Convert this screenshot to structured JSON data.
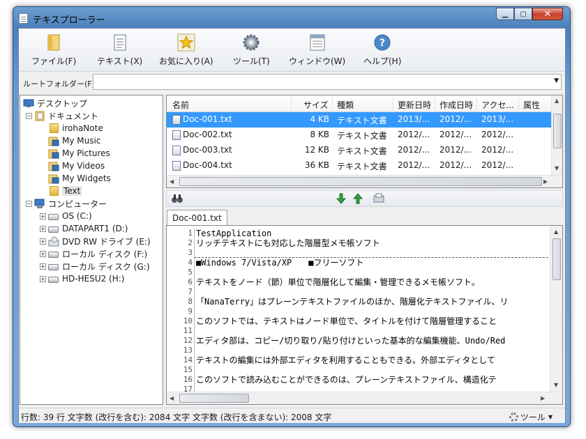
{
  "window": {
    "title": "テキスプローラー"
  },
  "toolbar": {
    "items": [
      {
        "label": "ファイル(F)",
        "icon": "folder-icon"
      },
      {
        "label": "テキスト(X)",
        "icon": "text-document-icon"
      },
      {
        "label": "お気に入り(A)",
        "icon": "star-icon"
      },
      {
        "label": "ツール(T)",
        "icon": "gear-icon"
      },
      {
        "label": "ウィンドウ(W)",
        "icon": "window-icon"
      },
      {
        "label": "ヘルプ(H)",
        "icon": "help-icon"
      }
    ]
  },
  "rootfolder": {
    "label": "ルートフォルダー(F):",
    "value": ""
  },
  "tree": {
    "desktop": "デスクトップ",
    "documents": "ドキュメント",
    "doc_children": [
      "irohaNote",
      "My Music",
      "My Pictures",
      "My Videos",
      "My Widgets",
      "Text"
    ],
    "computer": "コンピューター",
    "drives": [
      "OS (C:)",
      "DATAPART1 (D:)",
      "DVD RW ドライブ (E:)",
      "ローカル ディスク (F:)",
      "ローカル ディスク (G:)",
      "HD-HESU2 (H:)"
    ]
  },
  "filelist": {
    "columns": [
      "名前",
      "サイズ",
      "種類",
      "更新日時",
      "作成日時",
      "アクセ...",
      "属性"
    ],
    "rows": [
      {
        "name": "Doc-001.txt",
        "size": "4 KB",
        "type": "テキスト文書",
        "modified": "2013/...",
        "created": "2012/...",
        "accessed": "2013/...",
        "attr": ""
      },
      {
        "name": "Doc-002.txt",
        "size": "8 KB",
        "type": "テキスト文書",
        "modified": "2012/...",
        "created": "2012/...",
        "accessed": "2012/...",
        "attr": ""
      },
      {
        "name": "Doc-003.txt",
        "size": "12 KB",
        "type": "テキスト文書",
        "modified": "2012/...",
        "created": "2012/...",
        "accessed": "2012/...",
        "attr": ""
      },
      {
        "name": "Doc-004.txt",
        "size": "36 KB",
        "type": "テキスト文書",
        "modified": "2012/...",
        "created": "2012/...",
        "accessed": "2012/...",
        "attr": ""
      }
    ],
    "selected_index": 0
  },
  "editor": {
    "tab": "Doc-001.txt",
    "line_numbers": [
      "1",
      "2",
      "3",
      "4",
      "5",
      "6",
      "7",
      "8",
      "9",
      "10",
      "11",
      "12",
      "13",
      "14",
      "15",
      "16",
      "17"
    ],
    "lines": [
      "TestApplication",
      "リッチテキストにも対応した階層型メモ帳ソフト",
      "",
      "■Windows 7/Vista/XP　　■フリーソフト",
      "",
      "テキストをノード（節）単位で階層化して編集・管理できるメモ帳ソフト。",
      "",
      "「NanaTerry」はプレーンテキストファイルのほか、階層化テキストファイル、リ",
      "",
      "このソフトでは、テキストはノード単位で、タイトルを付けて階層管理すること",
      "",
      "エディタ部は、コピー/切り取り/貼り付けといった基本的な編集機能、Undo/Red",
      "",
      "テキストの編集には外部エディタを利用することもできる。外部エディタとして",
      "",
      "このソフトで読み込むことができるのは、プレーンテキストファイル、構造化テ",
      ""
    ]
  },
  "status": {
    "text": "行数: 39 行  文字数 (改行を含む): 2084 文字  文字数 (改行を含まない): 2008 文字",
    "tool_label": "ツール"
  }
}
